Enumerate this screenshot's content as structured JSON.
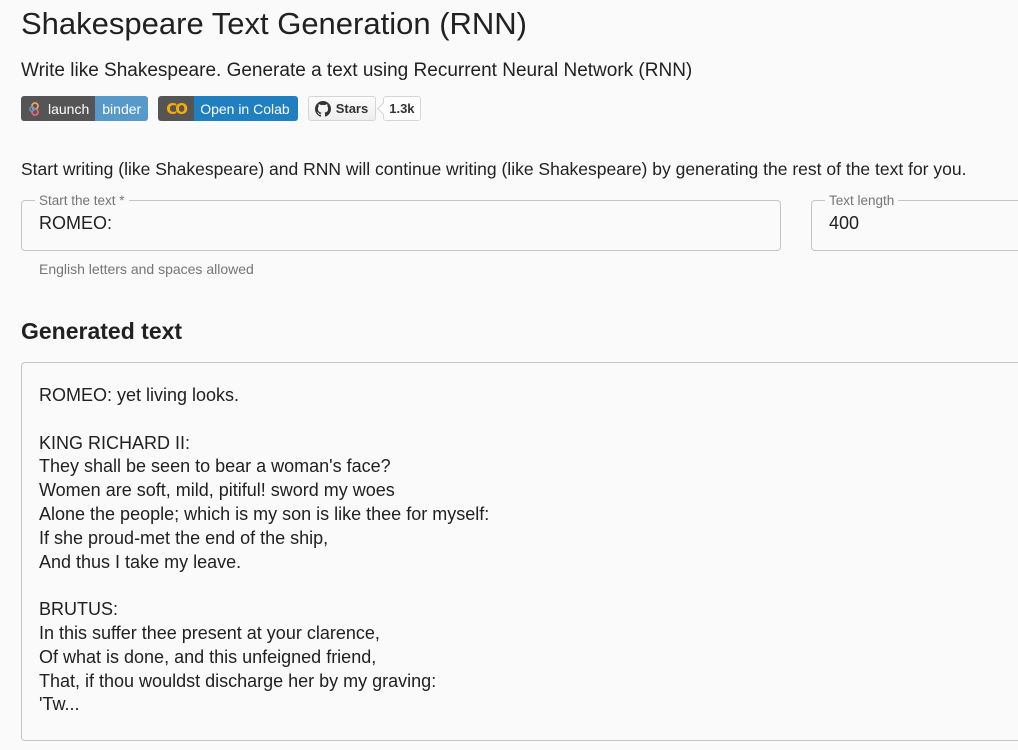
{
  "header": {
    "title": "Shakespeare Text Generation (RNN)",
    "subtitle": "Write like Shakespeare. Generate a text using Recurrent Neural Network (RNN)"
  },
  "badges": {
    "binder": {
      "left_label": "launch",
      "right_label": "binder",
      "color": "#579aca"
    },
    "colab": {
      "logo_text": "CO",
      "label": "Open in Colab",
      "color": "#1f7fbf"
    },
    "github": {
      "button_label": "Stars",
      "count": "1.3k"
    }
  },
  "intro": "Start writing (like Shakespeare) and RNN will continue writing (like Shakespeare) by generating the rest of the text for you.",
  "form": {
    "start_text": {
      "label": "Start the text *",
      "value": "ROMEO:",
      "helper": "English letters and spaces allowed"
    },
    "text_length": {
      "label": "Text length",
      "value": "400"
    }
  },
  "output": {
    "title": "Generated text",
    "text": "ROMEO: yet living looks.\n\nKING RICHARD II:\nThey shall be seen to bear a woman's face?\nWomen are soft, mild, pitiful! sword my woes\nAlone the people; which is my son is like thee for myself:\nIf she proud-met the end of the ship,\nAnd thus I take my leave.\n\nBRUTUS:\nIn this suffer thee present at your clarence,\nOf what is done, and this unfeigned friend,\nThat, if thou wouldst discharge her by my graving:\n'Tw..."
  }
}
